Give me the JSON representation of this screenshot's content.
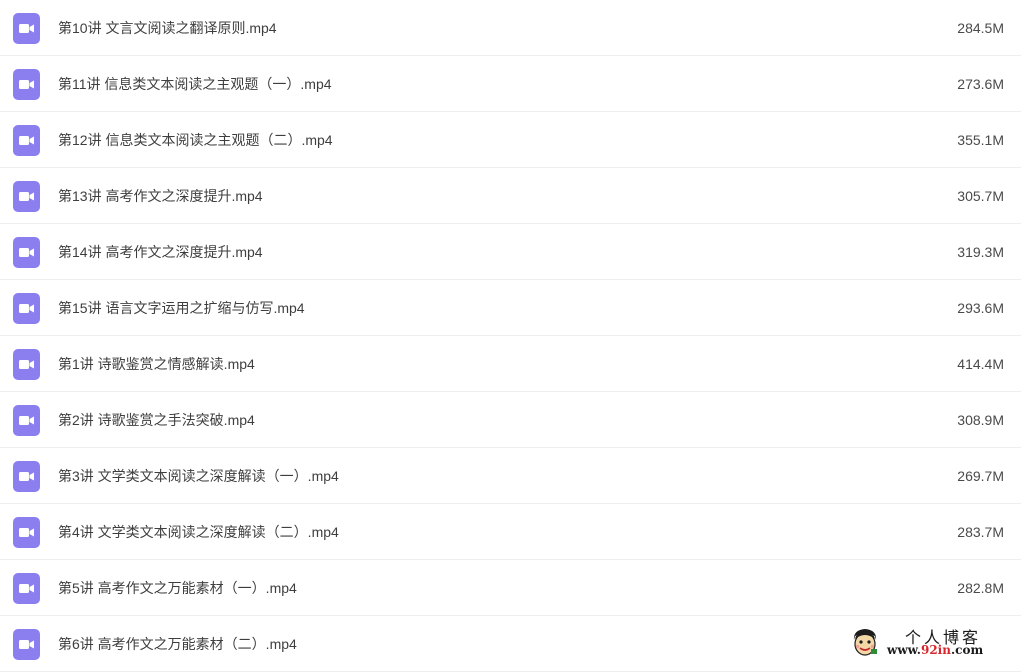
{
  "theme": {
    "icon_color": "#8b7ff0",
    "icon_glyph_color": "#ffffff",
    "row_divider": "#eeeeee"
  },
  "files": [
    {
      "name": "第10讲 文言文阅读之翻译原则.mp4",
      "size": "284.5M",
      "icon": "video-file-icon"
    },
    {
      "name": "第11讲 信息类文本阅读之主观题（一）.mp4",
      "size": "273.6M",
      "icon": "video-file-icon"
    },
    {
      "name": "第12讲 信息类文本阅读之主观题（二）.mp4",
      "size": "355.1M",
      "icon": "video-file-icon"
    },
    {
      "name": "第13讲 高考作文之深度提升.mp4",
      "size": "305.7M",
      "icon": "video-file-icon"
    },
    {
      "name": "第14讲 高考作文之深度提升.mp4",
      "size": "319.3M",
      "icon": "video-file-icon"
    },
    {
      "name": "第15讲 语言文字运用之扩缩与仿写.mp4",
      "size": "293.6M",
      "icon": "video-file-icon"
    },
    {
      "name": "第1讲 诗歌鉴赏之情感解读.mp4",
      "size": "414.4M",
      "icon": "video-file-icon"
    },
    {
      "name": "第2讲 诗歌鉴赏之手法突破.mp4",
      "size": "308.9M",
      "icon": "video-file-icon"
    },
    {
      "name": "第3讲 文学类文本阅读之深度解读（一）.mp4",
      "size": "269.7M",
      "icon": "video-file-icon"
    },
    {
      "name": "第4讲 文学类文本阅读之深度解读（二）.mp4",
      "size": "283.7M",
      "icon": "video-file-icon"
    },
    {
      "name": "第5讲 高考作文之万能素材（一）.mp4",
      "size": "282.8M",
      "icon": "video-file-icon"
    },
    {
      "name": "第6讲 高考作文之万能素材（二）.mp4",
      "size": "",
      "icon": "video-file-icon"
    }
  ],
  "watermark": {
    "title": "个人博客",
    "url_prefix": "www.",
    "url_highlight": "92in",
    "url_suffix": ".com",
    "icon": "cartoon-face-logo-icon"
  }
}
